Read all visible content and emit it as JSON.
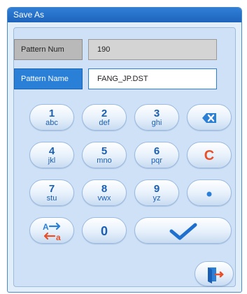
{
  "window": {
    "title": "Save As"
  },
  "fields": {
    "pattern_num": {
      "label": "Pattern Num",
      "value": "190"
    },
    "pattern_name": {
      "label": "Pattern Name",
      "value": "FANG_JP.DST"
    }
  },
  "keypad": {
    "k1": {
      "num": "1",
      "letters": "abc"
    },
    "k2": {
      "num": "2",
      "letters": "def"
    },
    "k3": {
      "num": "3",
      "letters": "ghi"
    },
    "k4": {
      "num": "4",
      "letters": "jkl"
    },
    "k5": {
      "num": "5",
      "letters": "mno"
    },
    "k6": {
      "num": "6",
      "letters": "pqr"
    },
    "k7": {
      "num": "7",
      "letters": "stu"
    },
    "k8": {
      "num": "8",
      "letters": "vwx"
    },
    "k9": {
      "num": "9",
      "letters": "yz"
    },
    "k0": {
      "num": "0"
    },
    "clear_label": "C"
  },
  "icons": {
    "backspace": "backspace-icon",
    "dot": "dot-icon",
    "case_toggle": "case-toggle-icon",
    "confirm": "checkmark-icon",
    "exit": "exit-door-icon"
  },
  "colors": {
    "accent": "#2a7fd7",
    "clear": "#e8502a",
    "key_text": "#1a5fb4"
  }
}
